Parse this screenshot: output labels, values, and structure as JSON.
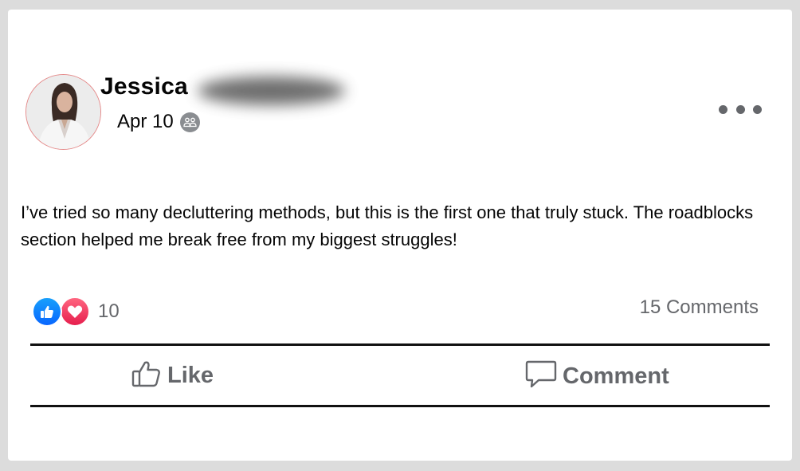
{
  "post": {
    "author_name": "Jessica",
    "date": "Apr 10",
    "text": "I’ve tried so many decluttering methods, but this is the first one that truly stuck. The roadblocks section helped me break free from my biggest struggles!",
    "reaction_count": "10",
    "comments_count": "15 Comments"
  },
  "actions": {
    "like_label": "Like",
    "comment_label": "Comment"
  },
  "icons": {
    "audience": "friends-icon",
    "more": "more-options-icon",
    "like_reaction": "thumbs-up-icon",
    "love_reaction": "heart-icon",
    "like_action": "thumbs-up-outline-icon",
    "comment_action": "comment-bubble-icon"
  },
  "colors": {
    "like_blue": "#0866ff",
    "love_red": "#e61e4d",
    "secondary_text": "#65676b",
    "avatar_border": "#e58a8a"
  }
}
